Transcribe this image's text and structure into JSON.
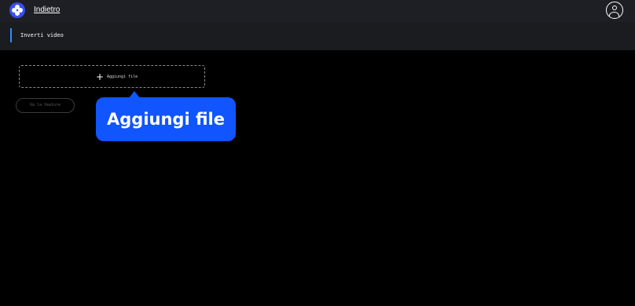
{
  "header": {
    "back_label": "Indietro",
    "logo_icon": "app-logo-icon",
    "user_icon": "user-account-icon"
  },
  "subheader": {
    "tab_label": "Inverti video",
    "indicator_color": "#2f8cff"
  },
  "main": {
    "add_file_label": "Aggiungi file",
    "add_icon": "plus-icon",
    "next_button_label": "Va la feature"
  },
  "tooltip": {
    "text": "Aggiungi file",
    "color": "#1155ff"
  }
}
